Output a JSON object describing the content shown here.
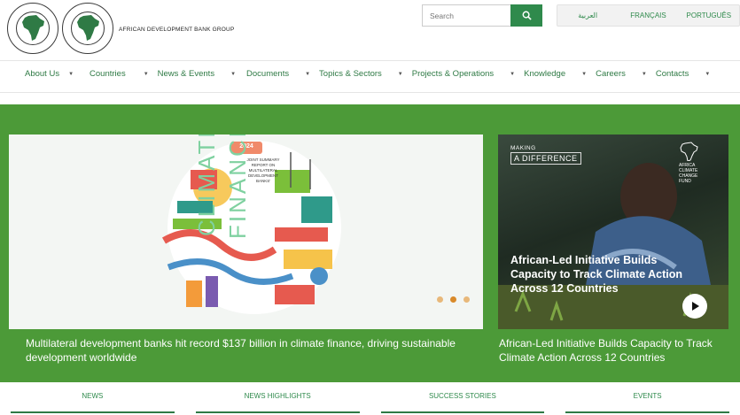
{
  "header": {
    "brand_name": "AFRICAN DEVELOPMENT BANK GROUP",
    "search_placeholder": "Search",
    "languages": [
      "العربية",
      "FRANÇAIS",
      "PORTUGUÊS"
    ]
  },
  "nav": {
    "items": [
      {
        "label": "About Us"
      },
      {
        "label": "Countries"
      },
      {
        "label": "News & Events"
      },
      {
        "label": "Documents"
      },
      {
        "label": "Topics & Sectors"
      },
      {
        "label": "Projects & Operations"
      },
      {
        "label": "Knowledge"
      },
      {
        "label": "Careers"
      },
      {
        "label": "Contacts"
      }
    ]
  },
  "carousel": {
    "main": {
      "year_badge": "2024",
      "report_label": "JOINT SUMMARY REPORT ON MULTILATERAL DEVELOPMENT BANKS'",
      "word1": "CLIMATE",
      "word2": "FINANCE",
      "caption": "Multilateral development banks hit record $137 billion in climate finance, driving sustainable development worldwide"
    },
    "side": {
      "kicker": "MAKING",
      "kicker_big": "A DIFFERENCE",
      "fund_label": "AFRICA CLIMATE CHANGE FUND",
      "overlay_title": "African-Led Initiative Builds Capacity to Track Climate Action Across 12 Countries",
      "caption": "African-Led Initiative Builds Capacity to Track Climate Action Across 12 Countries"
    },
    "dots": 3,
    "active_dot": 1
  },
  "tabs": [
    {
      "label": "NEWS"
    },
    {
      "label": "NEWS HIGHLIGHTS"
    },
    {
      "label": "SUCCESS STORIES"
    },
    {
      "label": "EVENTS"
    }
  ],
  "colors": {
    "brand_green": "#2f8a4c",
    "band_green": "#4c9a38",
    "dot_active": "#d98a2a"
  }
}
